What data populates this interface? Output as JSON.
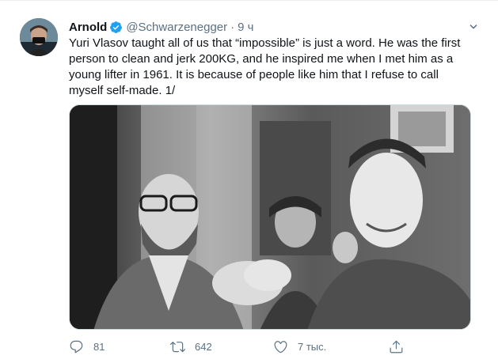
{
  "tweet": {
    "author": {
      "name": "Arnold",
      "handle": "@Schwarzenegger",
      "separator": "·",
      "time": "9 ч"
    },
    "text_lines": [
      "Yuri Vlasov taught all of us that “impossible” is just a word. He was the first",
      "person to clean and jerk 200KG, and he inspired me when I met him as a",
      "young lifter in 1961. It is because of people like him that I refuse to call",
      "myself self-made. 1/"
    ],
    "media": {
      "alt": "Black and white photo of a bearded man with glasses clasping hands with a smiling man in a polo shirt, young people watching behind them"
    },
    "actions": {
      "replies": "81",
      "retweets": "642",
      "likes": "7 тыс."
    },
    "colors": {
      "verified": "#1da1f2",
      "secondary_text": "#5b7083"
    },
    "icons": [
      "verified-badge-icon",
      "caret-down-icon",
      "reply-icon",
      "retweet-icon",
      "like-icon",
      "share-icon"
    ]
  }
}
